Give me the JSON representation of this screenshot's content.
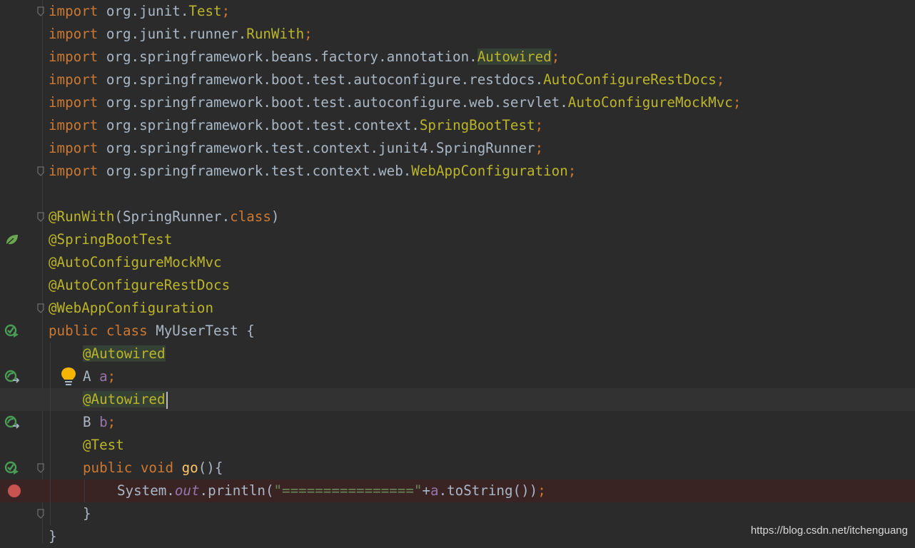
{
  "editor": {
    "file_lines": [
      {
        "tokens": [
          [
            "kw",
            "import "
          ],
          [
            "pkg",
            "org.junit."
          ],
          [
            "cls",
            "Test"
          ],
          [
            "semi",
            ";"
          ]
        ]
      },
      {
        "tokens": [
          [
            "kw",
            "import "
          ],
          [
            "pkg",
            "org.junit.runner."
          ],
          [
            "cls",
            "RunWith"
          ],
          [
            "semi",
            ";"
          ]
        ]
      },
      {
        "tokens": [
          [
            "kw",
            "import "
          ],
          [
            "pkg",
            "org.springframework.beans.factory.annotation."
          ],
          [
            "anncls",
            "Autowired"
          ],
          [
            "semi",
            ";"
          ]
        ]
      },
      {
        "tokens": [
          [
            "kw",
            "import "
          ],
          [
            "pkg",
            "org.springframework.boot.test.autoconfigure.restdocs."
          ],
          [
            "cls",
            "AutoConfigureRestDocs"
          ],
          [
            "semi",
            ";"
          ]
        ]
      },
      {
        "tokens": [
          [
            "kw",
            "import "
          ],
          [
            "pkg",
            "org.springframework.boot.test.autoconfigure.web.servlet."
          ],
          [
            "cls",
            "AutoConfigureMockMvc"
          ],
          [
            "semi",
            ";"
          ]
        ]
      },
      {
        "tokens": [
          [
            "kw",
            "import "
          ],
          [
            "pkg",
            "org.springframework.boot.test.context."
          ],
          [
            "cls",
            "SpringBootTest"
          ],
          [
            "semi",
            ";"
          ]
        ]
      },
      {
        "tokens": [
          [
            "kw",
            "import "
          ],
          [
            "pkg",
            "org.springframework.test.context.junit4.SpringRunner"
          ],
          [
            "semi",
            ";"
          ]
        ]
      },
      {
        "tokens": [
          [
            "kw",
            "import "
          ],
          [
            "pkg",
            "org.springframework.test.context.web."
          ],
          [
            "cls",
            "WebAppConfiguration"
          ],
          [
            "semi",
            ";"
          ]
        ]
      },
      {
        "tokens": []
      },
      {
        "tokens": [
          [
            "ann",
            "@RunWith"
          ],
          [
            "plain",
            "(SpringRunner."
          ],
          [
            "kw",
            "class"
          ],
          [
            "plain",
            ")"
          ]
        ]
      },
      {
        "tokens": [
          [
            "ann",
            "@SpringBootTest"
          ]
        ]
      },
      {
        "tokens": [
          [
            "ann",
            "@AutoConfigureMockMvc"
          ]
        ]
      },
      {
        "tokens": [
          [
            "ann",
            "@AutoConfigureRestDocs"
          ]
        ]
      },
      {
        "tokens": [
          [
            "ann",
            "@WebAppConfiguration"
          ]
        ]
      },
      {
        "tokens": [
          [
            "kw",
            "public class "
          ],
          [
            "plain",
            "MyUserTest {"
          ]
        ]
      },
      {
        "tokens": [
          [
            "anncls",
            "@Autowired"
          ]
        ],
        "indent": 1
      },
      {
        "tokens": [
          [
            "plain",
            "A "
          ],
          [
            "field",
            "a"
          ],
          [
            "semi",
            ";"
          ]
        ],
        "indent": 1
      },
      {
        "tokens": [
          [
            "anncls",
            "@Autowired"
          ]
        ],
        "indent": 1,
        "caret": true
      },
      {
        "tokens": [
          [
            "plain",
            "B "
          ],
          [
            "field",
            "b"
          ],
          [
            "semi",
            ";"
          ]
        ],
        "indent": 1
      },
      {
        "tokens": [
          [
            "ann",
            "@Test"
          ]
        ],
        "indent": 1
      },
      {
        "tokens": [
          [
            "kw",
            "public void "
          ],
          [
            "method",
            "go"
          ],
          [
            "plain",
            "(){"
          ]
        ],
        "indent": 1
      },
      {
        "tokens": [
          [
            "plain",
            "System."
          ],
          [
            "static",
            "out"
          ],
          [
            "plain",
            ".println("
          ],
          [
            "str",
            "\"================\""
          ],
          [
            "plain",
            "+"
          ],
          [
            "field",
            "a"
          ],
          [
            "plain",
            ".toString())"
          ],
          [
            "semi",
            ";"
          ]
        ],
        "indent": 2
      },
      {
        "tokens": [
          [
            "plain",
            "}"
          ]
        ],
        "indent": 1
      },
      {
        "tokens": [
          [
            "plain",
            "}"
          ]
        ]
      }
    ],
    "current_line": 17,
    "breakpoint_line": 21
  },
  "gutter": {
    "spring_leaf_icon_line": 10,
    "run_test_icon_lines": [
      14,
      20
    ],
    "bean_nav_icon_lines": [
      16,
      18
    ],
    "lightbulb_line": 16,
    "breakpoint_line": 21,
    "fold_markers": [
      0,
      7,
      9,
      13,
      20,
      22
    ]
  },
  "colors": {
    "background": "#2b2b2b",
    "keyword": "#cc7832",
    "annotation": "#bbb529",
    "field": "#9876aa",
    "string": "#6a8759",
    "breakpoint": "#c75450",
    "spring_icon": "#6aa84f"
  },
  "watermark": {
    "text": "https://blog.csdn.net/itchenguang"
  }
}
